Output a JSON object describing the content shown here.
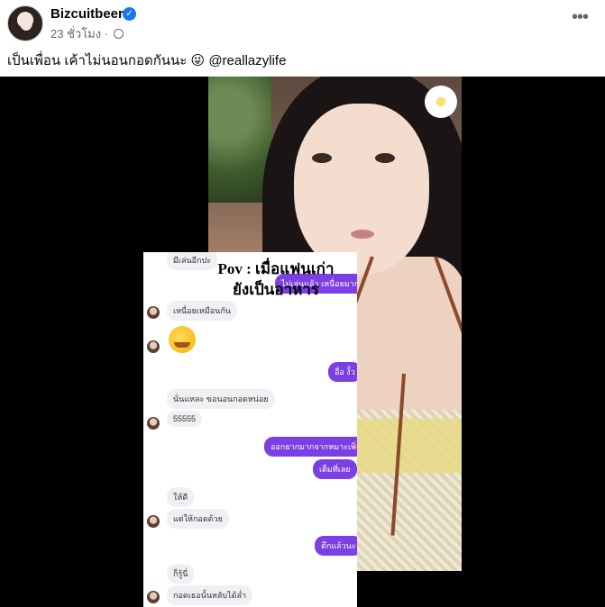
{
  "post": {
    "author": "Bizcuitbeer",
    "verified_glyph": "✓",
    "timestamp": "23 ชั่วโมง",
    "separator": "·",
    "more_glyph": "•••",
    "caption": "เป็นเพื่อน เค้าไม่นอนกอดกันนะ 😜 @reallazylife"
  },
  "media": {
    "overlay_title_line1": "Pov : เมื่อแฟนเก่า",
    "overlay_title_line2": "ยังเป็นอาหาร",
    "chat": [
      {
        "side": "in",
        "text": "มีเล่นอีกปะ"
      },
      {
        "side": "out",
        "text": "ไม่เล่นแล้ว เหนื่อยมาก"
      },
      {
        "side": "in",
        "text": "เหนื่อยเหมือนกัน"
      },
      {
        "side": "in",
        "text": "🫠",
        "type": "emoji"
      },
      {
        "side": "out",
        "text": "อื่อ งั้ว"
      },
      {
        "side": "in",
        "text": "นั่นแหละ ขอนอนกอดหน่อย"
      },
      {
        "side": "in",
        "text": "55555"
      },
      {
        "side": "out",
        "text": "ออกยากมากจากหมาะเพิ่ง"
      },
      {
        "side": "out",
        "text": "เต็มที่เลย"
      },
      {
        "side": "in",
        "text": "ให้ดี"
      },
      {
        "side": "in",
        "text": "แต่ให้กอดด้วย"
      },
      {
        "side": "out",
        "text": "ดึกแล้วนะ"
      },
      {
        "side": "in",
        "text": "ก็รู้นี่"
      },
      {
        "side": "in",
        "text": "กอดเธอนั้นหลับได้ล่ำ"
      }
    ]
  },
  "colors": {
    "brand_blue": "#1877f2",
    "outgoing_bubble": "#7b3fe4",
    "incoming_bubble": "#eef0f3"
  },
  "icons": {
    "verified": "verified-badge-icon",
    "privacy": "globe-icon",
    "more": "more-options-icon"
  }
}
